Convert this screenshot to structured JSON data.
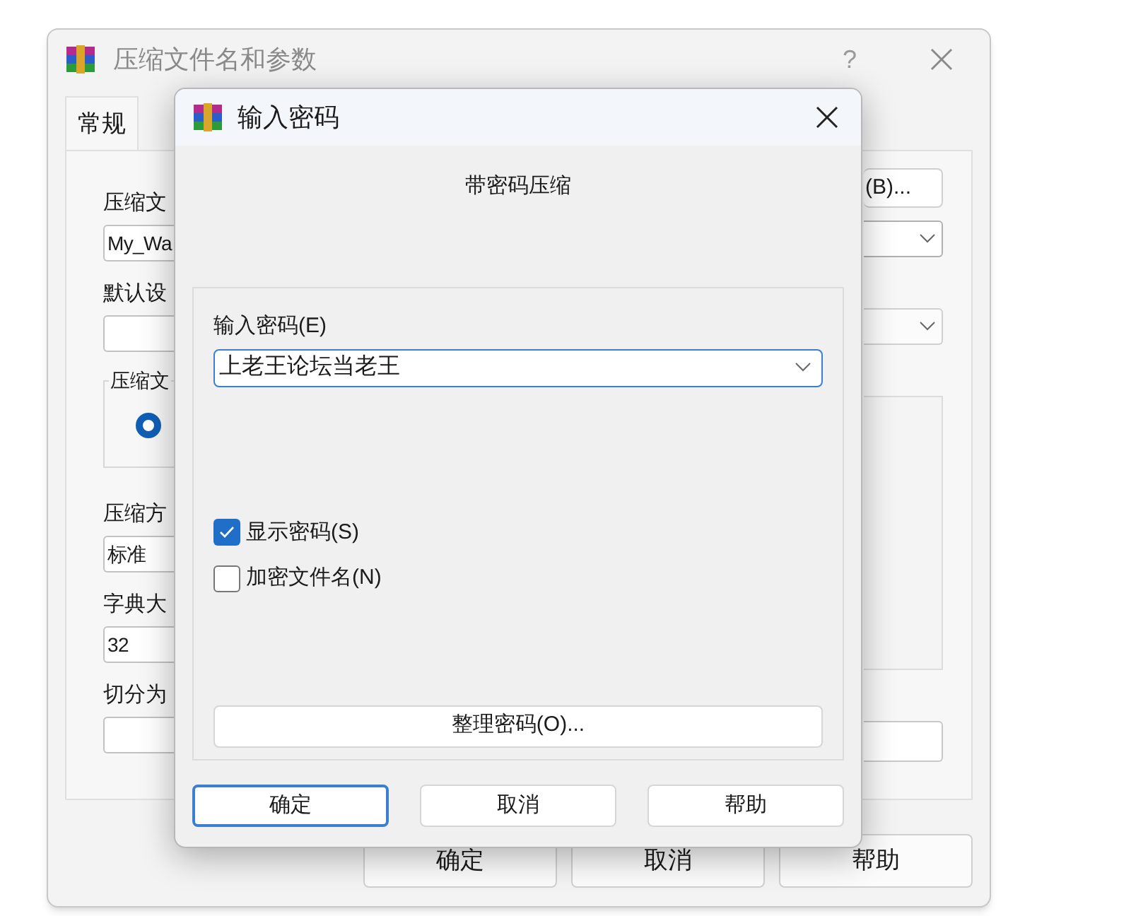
{
  "main_window": {
    "title": "压缩文件名和参数",
    "help": "?",
    "tabs": [
      {
        "label": "常规",
        "selected": true
      }
    ],
    "left_items": [
      {
        "kind": "label",
        "text": "压缩文"
      },
      {
        "kind": "field",
        "value": "My_Wa"
      },
      {
        "kind": "label",
        "text": "默认设"
      },
      {
        "kind": "field"
      },
      {
        "kind": "group",
        "label": "压缩文",
        "radio_selected": true
      },
      {
        "kind": "label",
        "text": "压缩方"
      },
      {
        "kind": "field",
        "value": "标准"
      },
      {
        "kind": "label",
        "text": "字典大"
      },
      {
        "kind": "field",
        "value": "32"
      },
      {
        "kind": "label",
        "text": "切分为"
      },
      {
        "kind": "field"
      }
    ],
    "browse_button": "(B)...",
    "buttons": [
      "确定",
      "取消",
      "帮助"
    ]
  },
  "dialog": {
    "title": "输入密码",
    "heading": "带密码压缩",
    "password_label": "输入密码(E)",
    "password_value": "上老王论坛当老王",
    "options": [
      {
        "label": "显示密码(S)",
        "checked": true
      },
      {
        "label": "加密文件名(N)",
        "checked": false
      }
    ],
    "organize_button": "整理密码(O)...",
    "buttons": [
      {
        "label": "确定",
        "default": true
      },
      {
        "label": "取消",
        "default": false
      },
      {
        "label": "帮助",
        "default": false
      }
    ]
  }
}
